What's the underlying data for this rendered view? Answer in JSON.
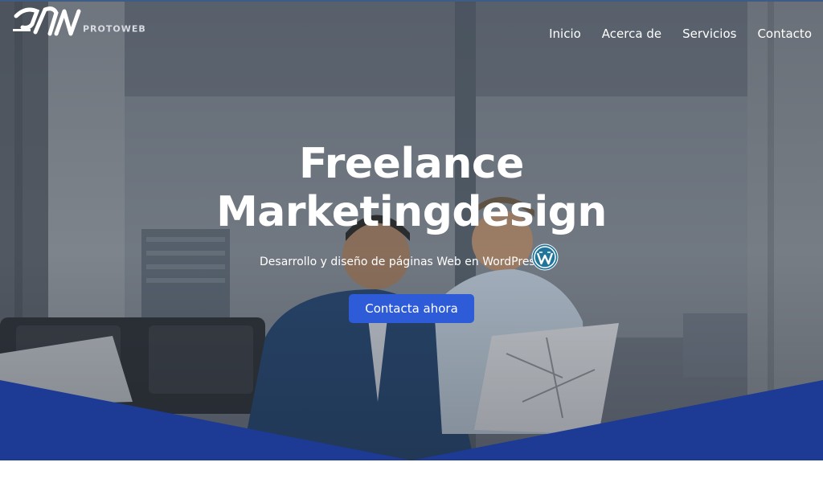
{
  "brand": {
    "name": "PROTOWEB"
  },
  "nav": {
    "items": [
      {
        "label": "Inicio"
      },
      {
        "label": "Acerca de"
      },
      {
        "label": "Servicios"
      },
      {
        "label": "Contacto"
      }
    ]
  },
  "hero": {
    "title_line1": "Freelance",
    "title_line2": "Marketingdesign",
    "subtitle": "Desarrollo y diseño de páginas Web en WordPress.",
    "cta_label": "Contacta ahora",
    "icon": "wordpress-icon"
  },
  "colors": {
    "accent": "#2e5bd8",
    "bottom_shape": "#1d3a94",
    "text": "#ffffff"
  }
}
